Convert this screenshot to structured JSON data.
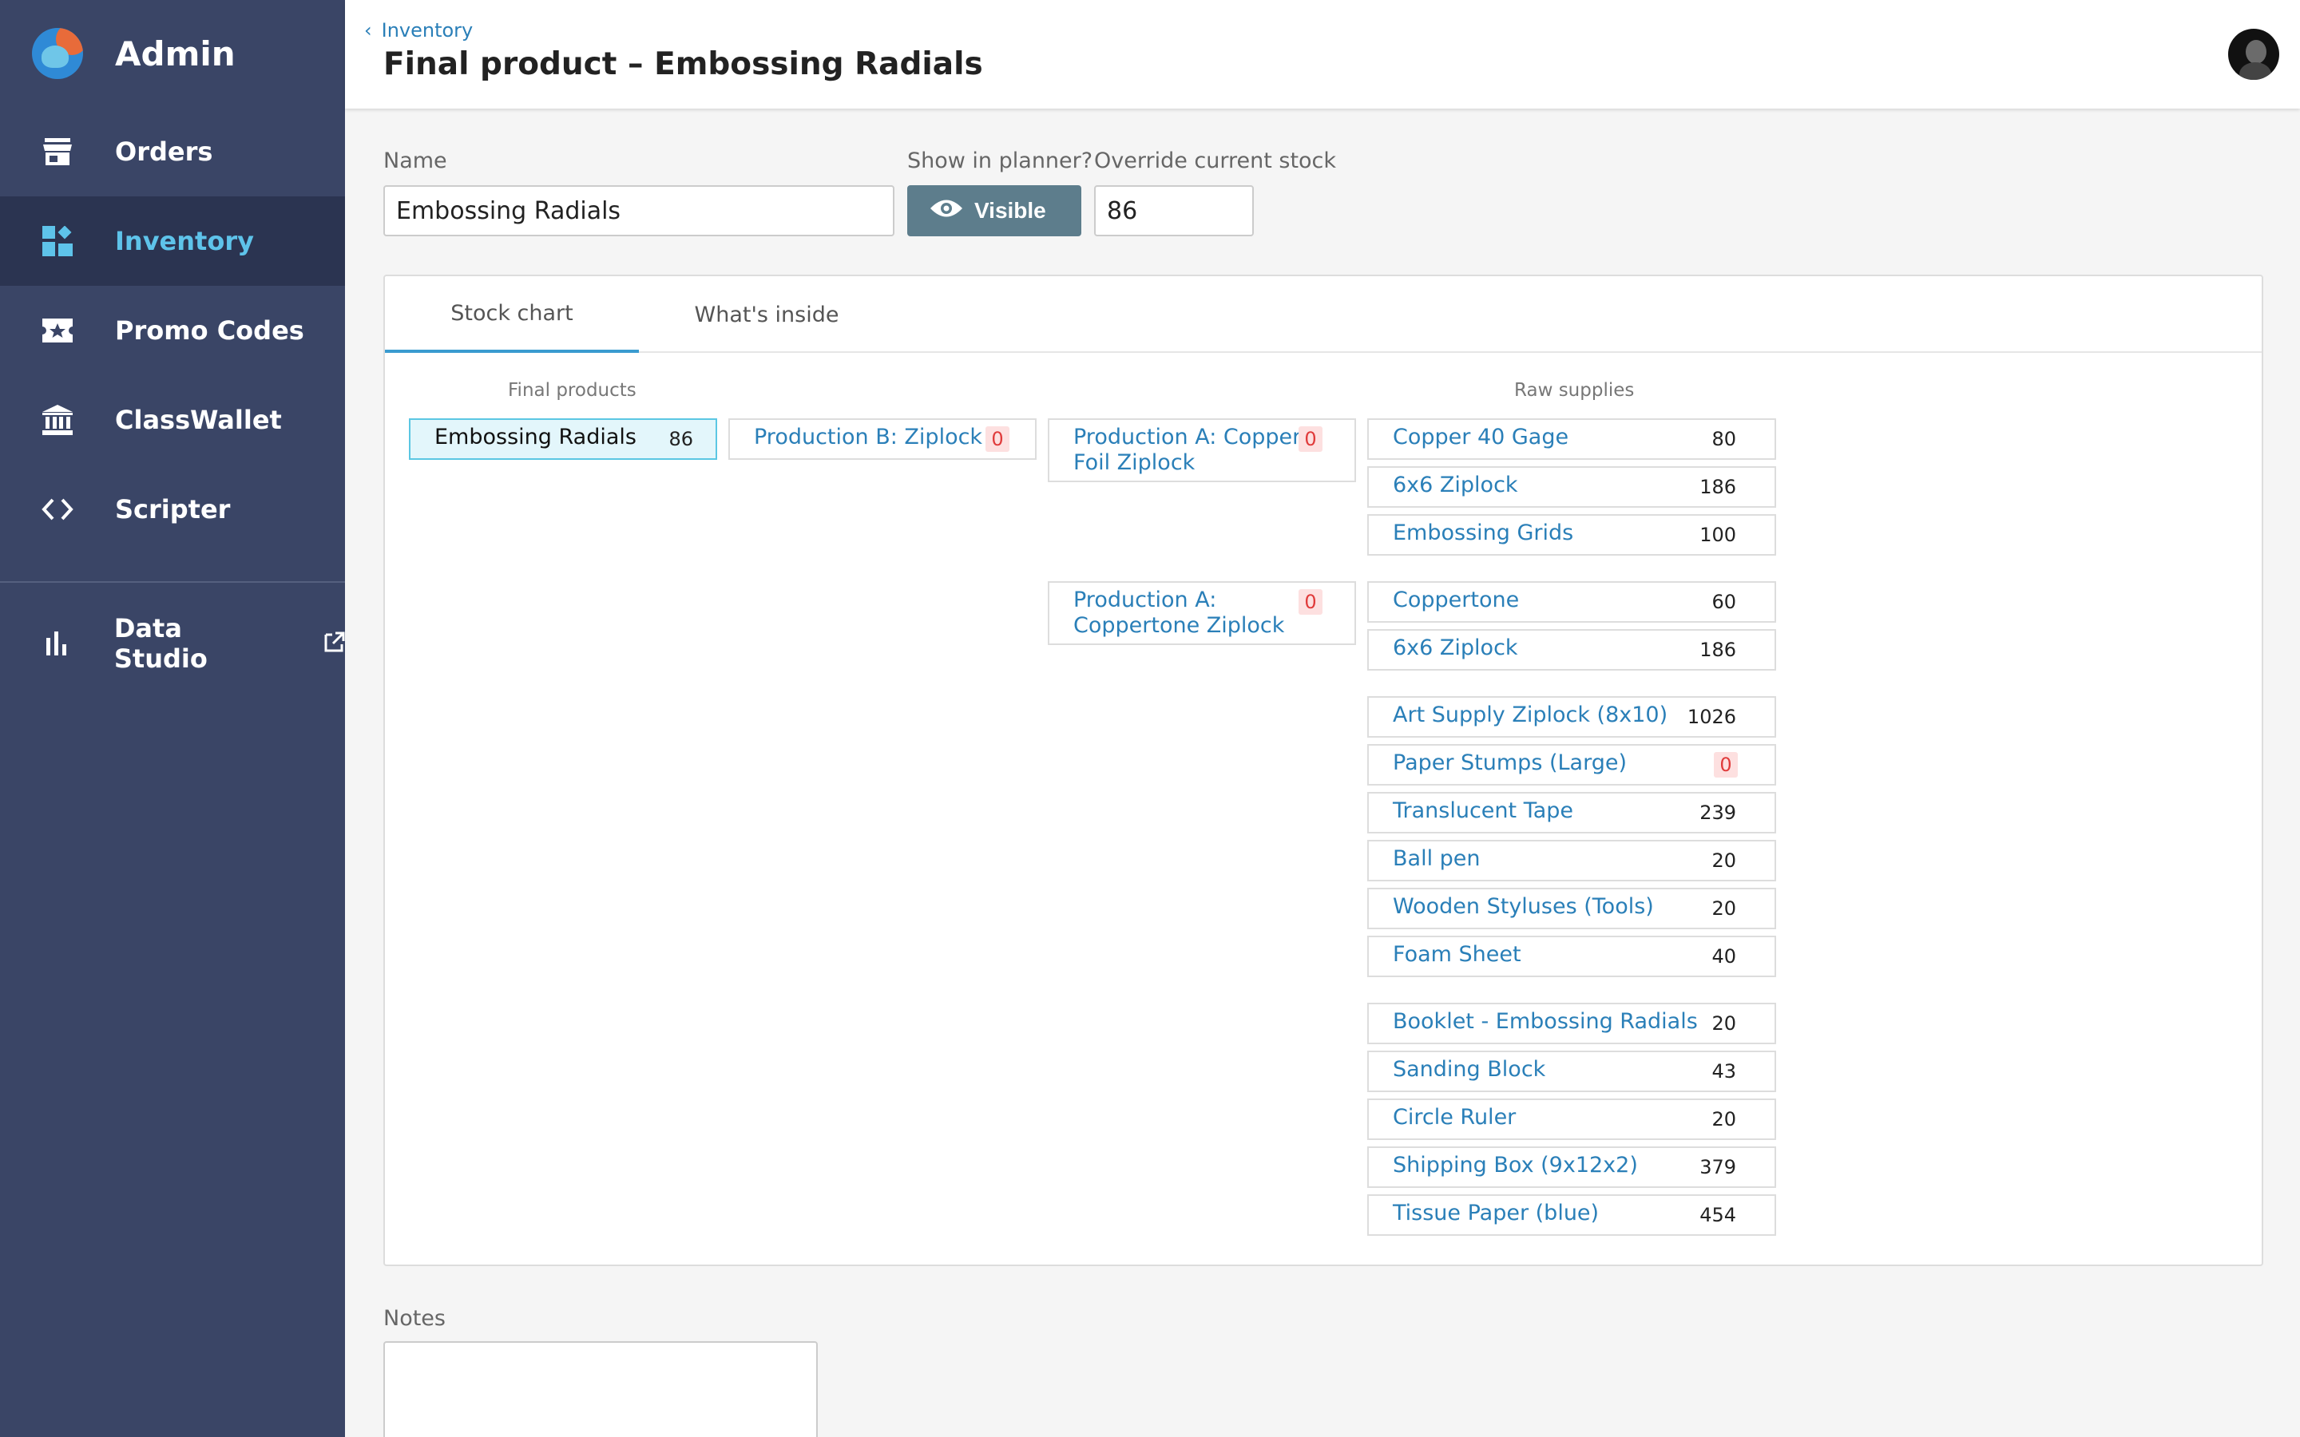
{
  "sidebar": {
    "brand": "Admin",
    "items": [
      {
        "label": "Orders"
      },
      {
        "label": "Inventory"
      },
      {
        "label": "Promo Codes"
      },
      {
        "label": "ClassWallet"
      },
      {
        "label": "Scripter"
      }
    ],
    "external": {
      "label": "Data Studio"
    }
  },
  "header": {
    "breadcrumb": "Inventory",
    "title": "Final product – Embossing Radials"
  },
  "form": {
    "name_label": "Name",
    "name_value": "Embossing Radials",
    "planner_label": "Show in planner?",
    "planner_button": "Visible",
    "stock_label": "Override current stock",
    "stock_value": "86"
  },
  "tabs": [
    "Stock chart",
    "What's inside"
  ],
  "chart": {
    "final_header": "Final products",
    "raw_header": "Raw supplies",
    "final_product": {
      "name": "Embossing Radials",
      "count": "86"
    },
    "production_b": {
      "name": "Production B: Ziplock",
      "count": "0"
    },
    "production_a1": {
      "name_line1": "Production A: Copper",
      "name_line2": "Foil Ziplock",
      "count": "0"
    },
    "production_a2": {
      "name_line1": "Production A:",
      "name_line2": "Coppertone Ziplock",
      "count": "0"
    },
    "group1": [
      {
        "name": "Copper 40 Gage",
        "count": "80"
      },
      {
        "name": "6x6 Ziplock",
        "count": "186"
      },
      {
        "name": "Embossing Grids",
        "count": "100"
      }
    ],
    "group2": [
      {
        "name": "Coppertone",
        "count": "60"
      },
      {
        "name": "6x6 Ziplock",
        "count": "186"
      }
    ],
    "group3": [
      {
        "name": "Art Supply Ziplock (8x10)",
        "count": "1026"
      },
      {
        "name": "Paper Stumps (Large)",
        "count": "0"
      },
      {
        "name": "Translucent Tape",
        "count": "239"
      },
      {
        "name": "Ball pen",
        "count": "20"
      },
      {
        "name": "Wooden Styluses (Tools)",
        "count": "20"
      },
      {
        "name": "Foam Sheet",
        "count": "40"
      }
    ],
    "group4": [
      {
        "name": "Booklet - Embossing Radials",
        "count": "20"
      },
      {
        "name": "Sanding Block",
        "count": "43"
      },
      {
        "name": "Circle Ruler",
        "count": "20"
      },
      {
        "name": "Shipping Box (9x12x2)",
        "count": "379"
      },
      {
        "name": "Tissue Paper (blue)",
        "count": "454"
      }
    ]
  },
  "notes_label": "Notes"
}
